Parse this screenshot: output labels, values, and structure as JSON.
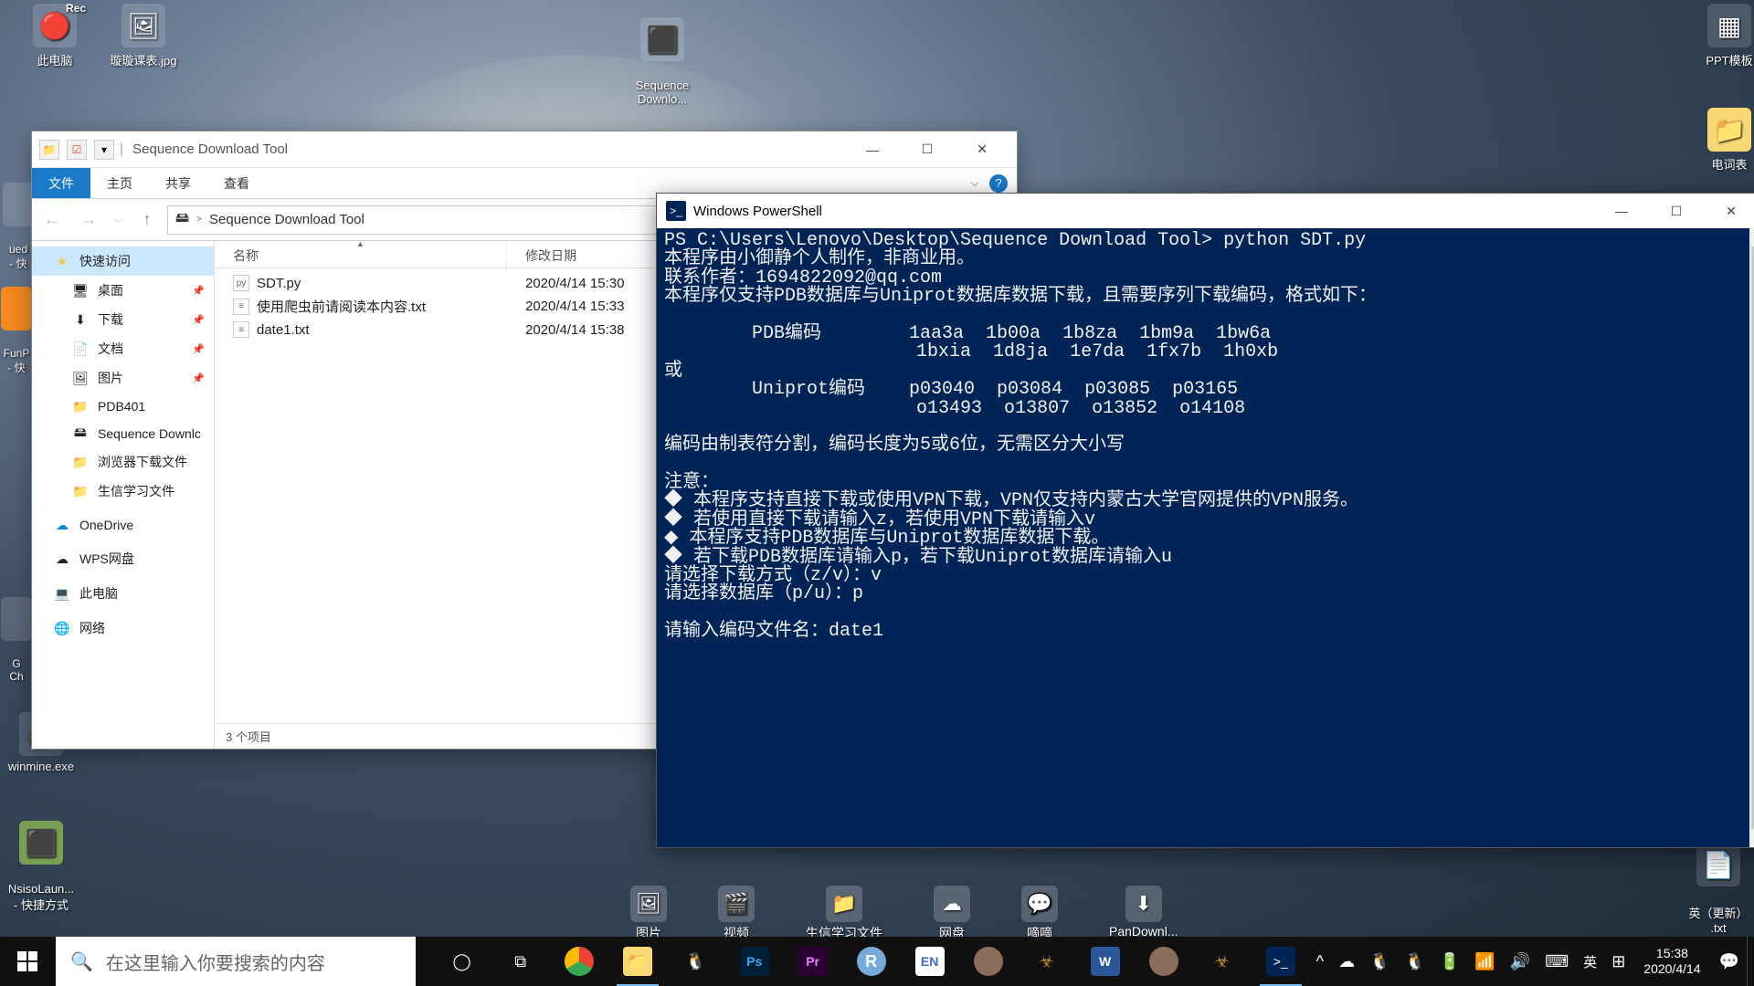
{
  "desktop_icons": {
    "this_pc": "此电脑",
    "xuanxuan": "璇璇课表.jpg",
    "seq_dl": "Sequence\nDownlo...",
    "ppt_tmpl": "PPT模板",
    "dict": "电词表",
    "winmine": "winmine.exe",
    "nsiso": "NsisoLaun...\n- 快捷方式",
    "gch_hidden": "G\nCh",
    "ued": "ued\n- 快",
    "funp": "FunP\n- 快",
    "yi_update": "英（更新）\n.txt"
  },
  "explorer": {
    "title": "Sequence Download Tool",
    "ribbon": {
      "file": "文件",
      "home": "主页",
      "share": "共享",
      "view": "查看"
    },
    "breadcrumb": {
      "root_icon": "▸",
      "folder": "Sequence Download Tool",
      "sep": ">"
    },
    "nav": {
      "quick": "快速访问",
      "desktop": "桌面",
      "downloads": "下载",
      "documents": "文档",
      "pictures": "图片",
      "pdb401": "PDB401",
      "seqdl": "Sequence Downlc",
      "browserdl": "浏览器下载文件",
      "biostudy": "生信学习文件",
      "onedrive": "OneDrive",
      "wps": "WPS网盘",
      "thispc": "此电脑",
      "network": "网络"
    },
    "columns": {
      "name": "名称",
      "date": "修改日期"
    },
    "files": [
      {
        "name": "SDT.py",
        "date": "2020/4/14 15:30"
      },
      {
        "name": "使用爬虫前请阅读本内容.txt",
        "date": "2020/4/14 15:33"
      },
      {
        "name": "date1.txt",
        "date": "2020/4/14 15:38"
      }
    ],
    "status": "3 个项目"
  },
  "powershell": {
    "title": "Windows PowerShell",
    "content": "PS C:\\Users\\Lenovo\\Desktop\\Sequence Download Tool> python SDT.py\n本程序由小御静个人制作，非商业用。\n联系作者：1694822092@qq.com\n本程序仅支持PDB数据库与Uniprot数据库数据下载，且需要序列下载编码，格式如下：\n\n        PDB编码        1aa3a  1b00a  1b8za  1bm9a  1bw6a\n                       1bxia  1d8ja  1e7da  1fx7b  1h0xb\n或\n        Uniprot编码    p03040  p03084  p03085  p03165\n                       o13493  o13807  o13852  o14108\n\n编码由制表符分割，编码长度为5或6位，无需区分大小写\n\n注意：\n◆ 本程序支持直接下载或使用VPN下载，VPN仅支持内蒙古大学官网提供的VPN服务。\n◆ 若使用直接下载请输入z，若使用VPN下载请输入v\n◆ 本程序支持PDB数据库与Uniprot数据库数据下载。\n◆ 若下载PDB数据库请输入p，若下载Uniprot数据库请输入u\n请选择下载方式（z/v）：v\n请选择数据库（p/u）：p\n\n请输入编码文件名：date1"
  },
  "secondary_bar": {
    "pictures": "图片",
    "video": "视频",
    "biostudy": "生信学习文件",
    "netdisk": "网盘",
    "bibi": "嘀嘀",
    "pandl": "PanDownl..."
  },
  "taskbar": {
    "search_placeholder": "在这里输入你要搜索的内容",
    "ime": "英",
    "notif": "☰",
    "chevup": "^",
    "clock_time": "15:38",
    "clock_date": "2020/4/14"
  }
}
